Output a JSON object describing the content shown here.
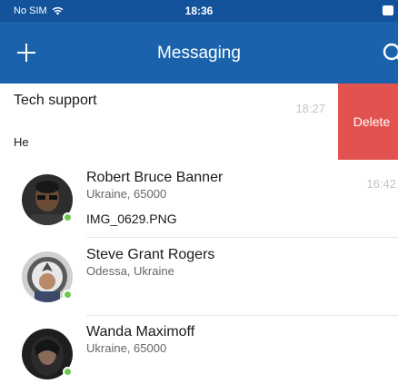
{
  "status_bar": {
    "carrier": "No SIM",
    "time": "18:36"
  },
  "nav": {
    "title": "Messaging",
    "add_icon": "plus-icon",
    "search_icon": "search-icon"
  },
  "swiped_chat": {
    "name": "Tech support",
    "time": "18:27",
    "preview": "He",
    "delete_label": "Delete",
    "delete_color": "#e2524f"
  },
  "contacts": [
    {
      "name": "Robert Bruce Banner",
      "subtitle": "Ukraine, 65000",
      "attachment": "IMG_0629.PNG",
      "time": "16:42",
      "online": true
    },
    {
      "name": "Steve Grant Rogers",
      "subtitle": "Odessa, Ukraine",
      "online": true
    },
    {
      "name": "Wanda Maximoff",
      "subtitle": "Ukraine, 65000",
      "online": true
    }
  ],
  "colors": {
    "status_bar": "#13539c",
    "nav_bar": "#1a63ac",
    "online": "#6cc94e"
  }
}
